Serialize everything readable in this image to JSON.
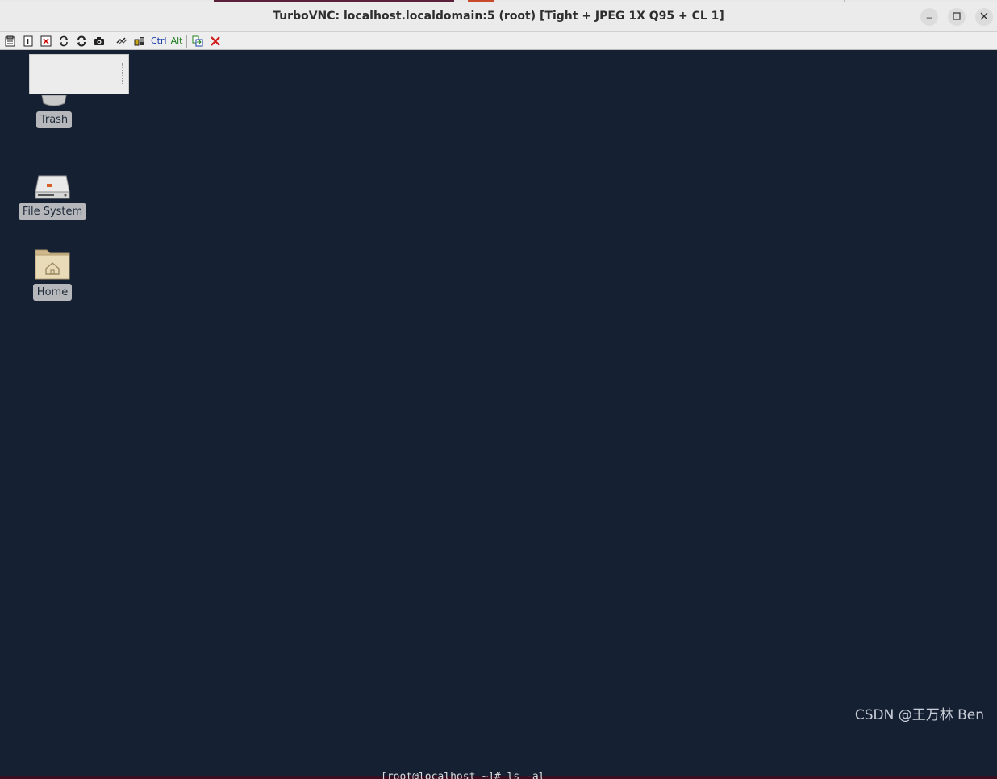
{
  "window": {
    "title": "TurboVNC: localhost.localdomain:5 (root) [Tight + JPEG 1X Q95 + CL 1]",
    "controls": {
      "minimize": "–",
      "maximize": "☐",
      "close": "✕"
    }
  },
  "toolbar": {
    "items": [
      {
        "name": "options-icon"
      },
      {
        "name": "info-icon"
      },
      {
        "name": "fullscreen-icon"
      },
      {
        "name": "refresh-icon"
      },
      {
        "name": "request-refresh-icon"
      },
      {
        "name": "screenshot-icon"
      },
      {
        "name": "lossless-refresh-icon"
      },
      {
        "name": "view-only-icon"
      }
    ],
    "ctrl_label": "Ctrl",
    "alt_label": "Alt",
    "transfer_icon": "clipboard-transfer-icon",
    "disconnect_icon": "disconnect-icon",
    "disconnect_color": "#d11a1a"
  },
  "desktop": {
    "background": "#162033",
    "icons": [
      {
        "label": "Trash",
        "icon": "trash-icon"
      },
      {
        "label": "File System",
        "icon": "drive-icon"
      },
      {
        "label": "Home",
        "icon": "home-folder-icon"
      }
    ]
  },
  "watermark": "CSDN @王万林 Ben",
  "host_terminal_fragment": "[root@localhost ~]# ls -al"
}
